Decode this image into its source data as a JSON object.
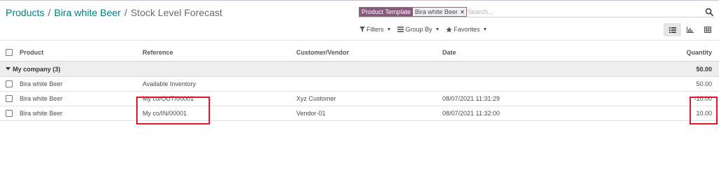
{
  "breadcrumb": {
    "items": [
      {
        "label": "Products"
      },
      {
        "label": "Bira white Beer"
      },
      {
        "label": "Stock Level Forecast"
      }
    ],
    "separator": "/"
  },
  "search": {
    "facet_category": "Product Template",
    "facet_value": "Bira white Beer",
    "facet_remove": "×",
    "placeholder": "Search...",
    "icon": "search-icon"
  },
  "menus": {
    "filters": {
      "label": "Filters",
      "icon": "filter-icon"
    },
    "group_by": {
      "label": "Group By",
      "icon": "list-bars-icon"
    },
    "favorites": {
      "label": "Favorites",
      "icon": "star-icon"
    }
  },
  "views": [
    {
      "name": "list",
      "icon": "list-view-icon",
      "active": true
    },
    {
      "name": "graph",
      "icon": "bar-chart-icon",
      "active": false
    },
    {
      "name": "pivot",
      "icon": "pivot-table-icon",
      "active": false
    }
  ],
  "table": {
    "columns": {
      "product": "Product",
      "reference": "Reference",
      "customer": "Customer/Vendor",
      "date": "Date",
      "quantity": "Quantity"
    },
    "group": {
      "label": "My company (3)",
      "total": "50.00"
    },
    "rows": [
      {
        "product": "Bira white Beer",
        "reference": "Available Inventory",
        "customer": "",
        "date": "",
        "quantity": "50.00"
      },
      {
        "product": "Bira white Beer",
        "reference": "My co/OUT/00001",
        "customer": "Xyz Customer",
        "date": "08/07/2021 11:31:29",
        "quantity": "-10.00"
      },
      {
        "product": "Bira white Beer",
        "reference": "My co/IN/00001",
        "customer": "Vendor-01",
        "date": "08/07/2021 11:32:00",
        "quantity": "10.00"
      }
    ]
  },
  "colors": {
    "link": "#017e84",
    "facet": "#875a7b",
    "highlight": "#e4162f",
    "group_bg": "#eeeeee"
  }
}
